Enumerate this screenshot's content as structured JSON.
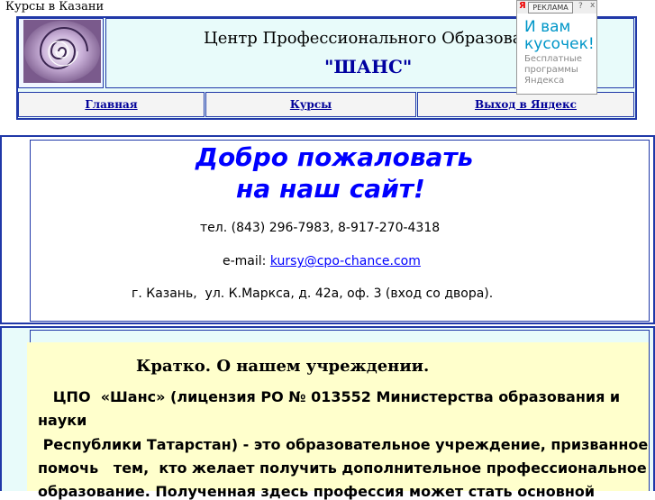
{
  "site_title": "Курсы в Казани",
  "header": {
    "center_name": "Центр Профессионального Образования",
    "center_quote": "\"ШАНС\"",
    "logo_icon": "fractal-spiral-logo"
  },
  "nav": {
    "items": [
      {
        "label": "Главная"
      },
      {
        "label": "Курсы"
      },
      {
        "label": "Выход в Яндекс"
      }
    ]
  },
  "ad": {
    "logo": "Я",
    "label": "РЕКЛАМА",
    "help": "?",
    "close": "x",
    "line1": "И вам",
    "line2": "кусочек!",
    "sub1": "Бесплатные",
    "sub2": "программы",
    "sub3": "Яндекса"
  },
  "welcome": {
    "line1": "Добро пожаловать",
    "line2": "на наш сайт!",
    "phone": "тел. (843) 296-7983, 8-917-270-4318",
    "email_label": "e-mail:",
    "email": "kursy@cpo-chance.com",
    "address": "г. Казань,  ул. К.Маркса, д. 42а, оф. 3 (вход со двора)."
  },
  "about": {
    "heading": "Кратко. О нашем учреждении.",
    "lines": [
      "   ЦПО  «Шанс» (лицензия РО № 013552 Министерства образования и",
      "науки",
      " Республики Татарстан) - это образовательное учреждение, призванное",
      "помочь   тем,  кто желает получить дополнительное профессиональное",
      "образование. Полученная здесь профессия может стать основной"
    ]
  },
  "colors": {
    "border": "#2038a8",
    "welcome_text": "#0000ff",
    "panel_bg": "#ffffcc",
    "section_bg": "#e8fbfa"
  }
}
